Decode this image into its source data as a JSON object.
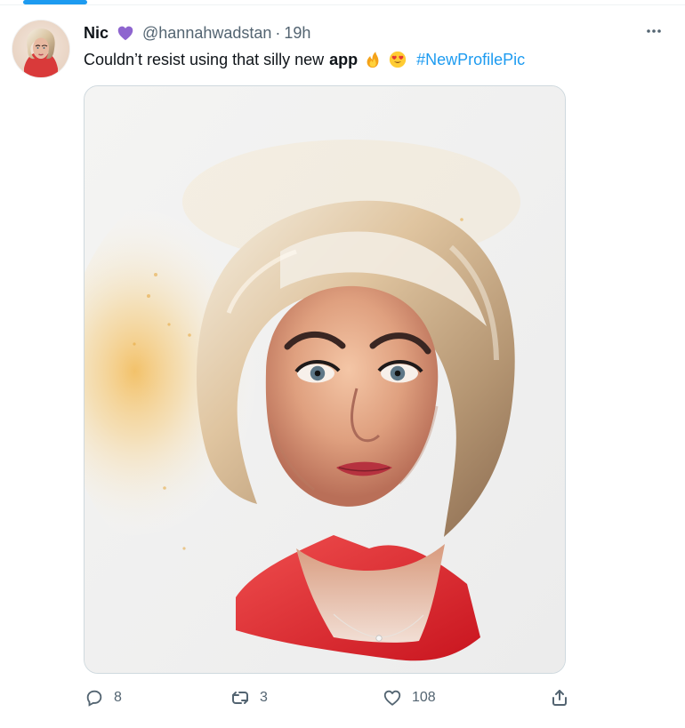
{
  "tweet": {
    "display_name": "Nic",
    "handle": "@hannahwadstan",
    "separator": "·",
    "time": "19h",
    "text_before_bold": "Couldn’t resist using that silly new",
    "text_bold": "app",
    "hashtag": "#NewProfilePic",
    "emojis": [
      "fire-emoji",
      "heart-eyes-emoji"
    ]
  },
  "header": {
    "more_icon": "more-icon"
  },
  "actions": {
    "reply": {
      "count": "8",
      "icon": "reply-icon"
    },
    "retweet": {
      "count": "3",
      "icon": "retweet-icon"
    },
    "like": {
      "count": "108",
      "icon": "like-icon"
    },
    "share": {
      "icon": "share-icon"
    }
  },
  "colors": {
    "accent": "#1d9bf0",
    "secondary_text": "#536471",
    "heart_badge": "#8e65cf"
  }
}
